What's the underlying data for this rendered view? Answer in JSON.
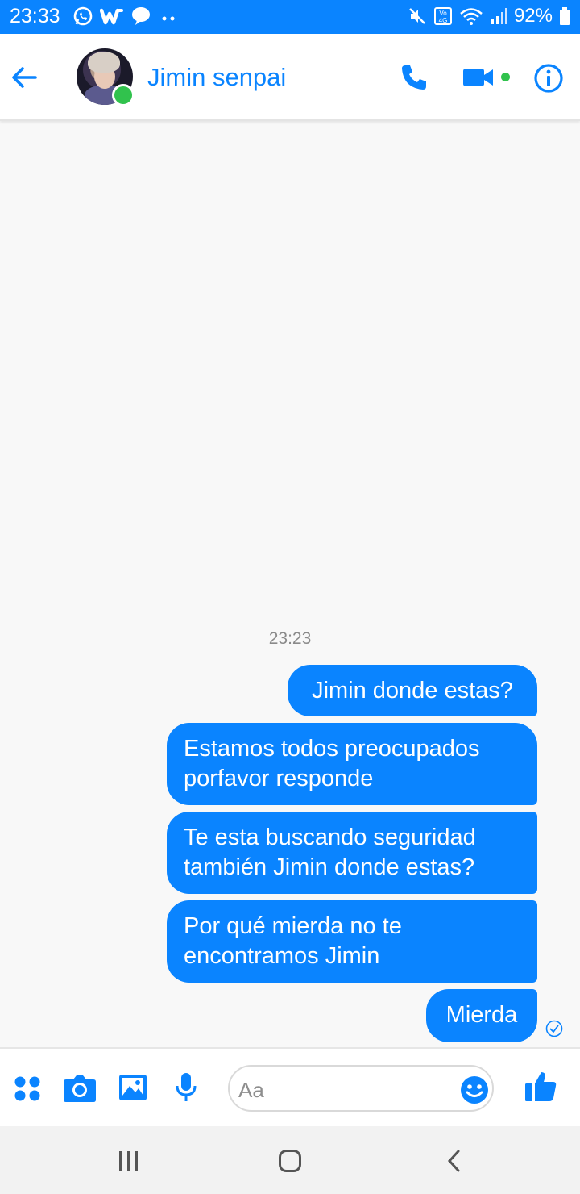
{
  "status_bar": {
    "time": "23:33",
    "left_icons": [
      "whatsapp-icon",
      "wattpad-icon",
      "chat-bubble-icon",
      "more-dots-icon"
    ],
    "right_icons": [
      "mute-icon",
      "volte-4g-icon",
      "wifi-icon",
      "signal-icon",
      "battery-icon"
    ],
    "battery": "92%"
  },
  "header": {
    "contact_name": "Jimin senpai",
    "online": true,
    "icons": [
      "back-arrow-icon",
      "phone-icon",
      "video-camera-icon",
      "info-icon"
    ]
  },
  "conversation": {
    "timestamp": "23:23",
    "messages": [
      {
        "text": "Jimin donde estas?",
        "from": "me"
      },
      {
        "text": "Estamos todos preocupados\nporfavor responde",
        "from": "me"
      },
      {
        "text": "Te esta buscando seguridad\ntambién Jimin donde estas?",
        "from": "me"
      },
      {
        "text": "Por qué mierda no te\nencontramos Jimin",
        "from": "me"
      },
      {
        "text": "Mierda",
        "from": "me"
      }
    ],
    "last_status_icon": "sent-check-icon"
  },
  "composer": {
    "placeholder": "Aa",
    "icons": [
      "more-apps-icon",
      "camera-icon",
      "gallery-icon",
      "microphone-icon",
      "emoji-icon",
      "thumbs-up-icon"
    ]
  },
  "nav_bar": {
    "icons": [
      "recents-icon",
      "home-icon",
      "back-icon"
    ]
  },
  "colors": {
    "accent": "#0a84ff",
    "online": "#31c24d",
    "background": "#f8f8f8"
  }
}
